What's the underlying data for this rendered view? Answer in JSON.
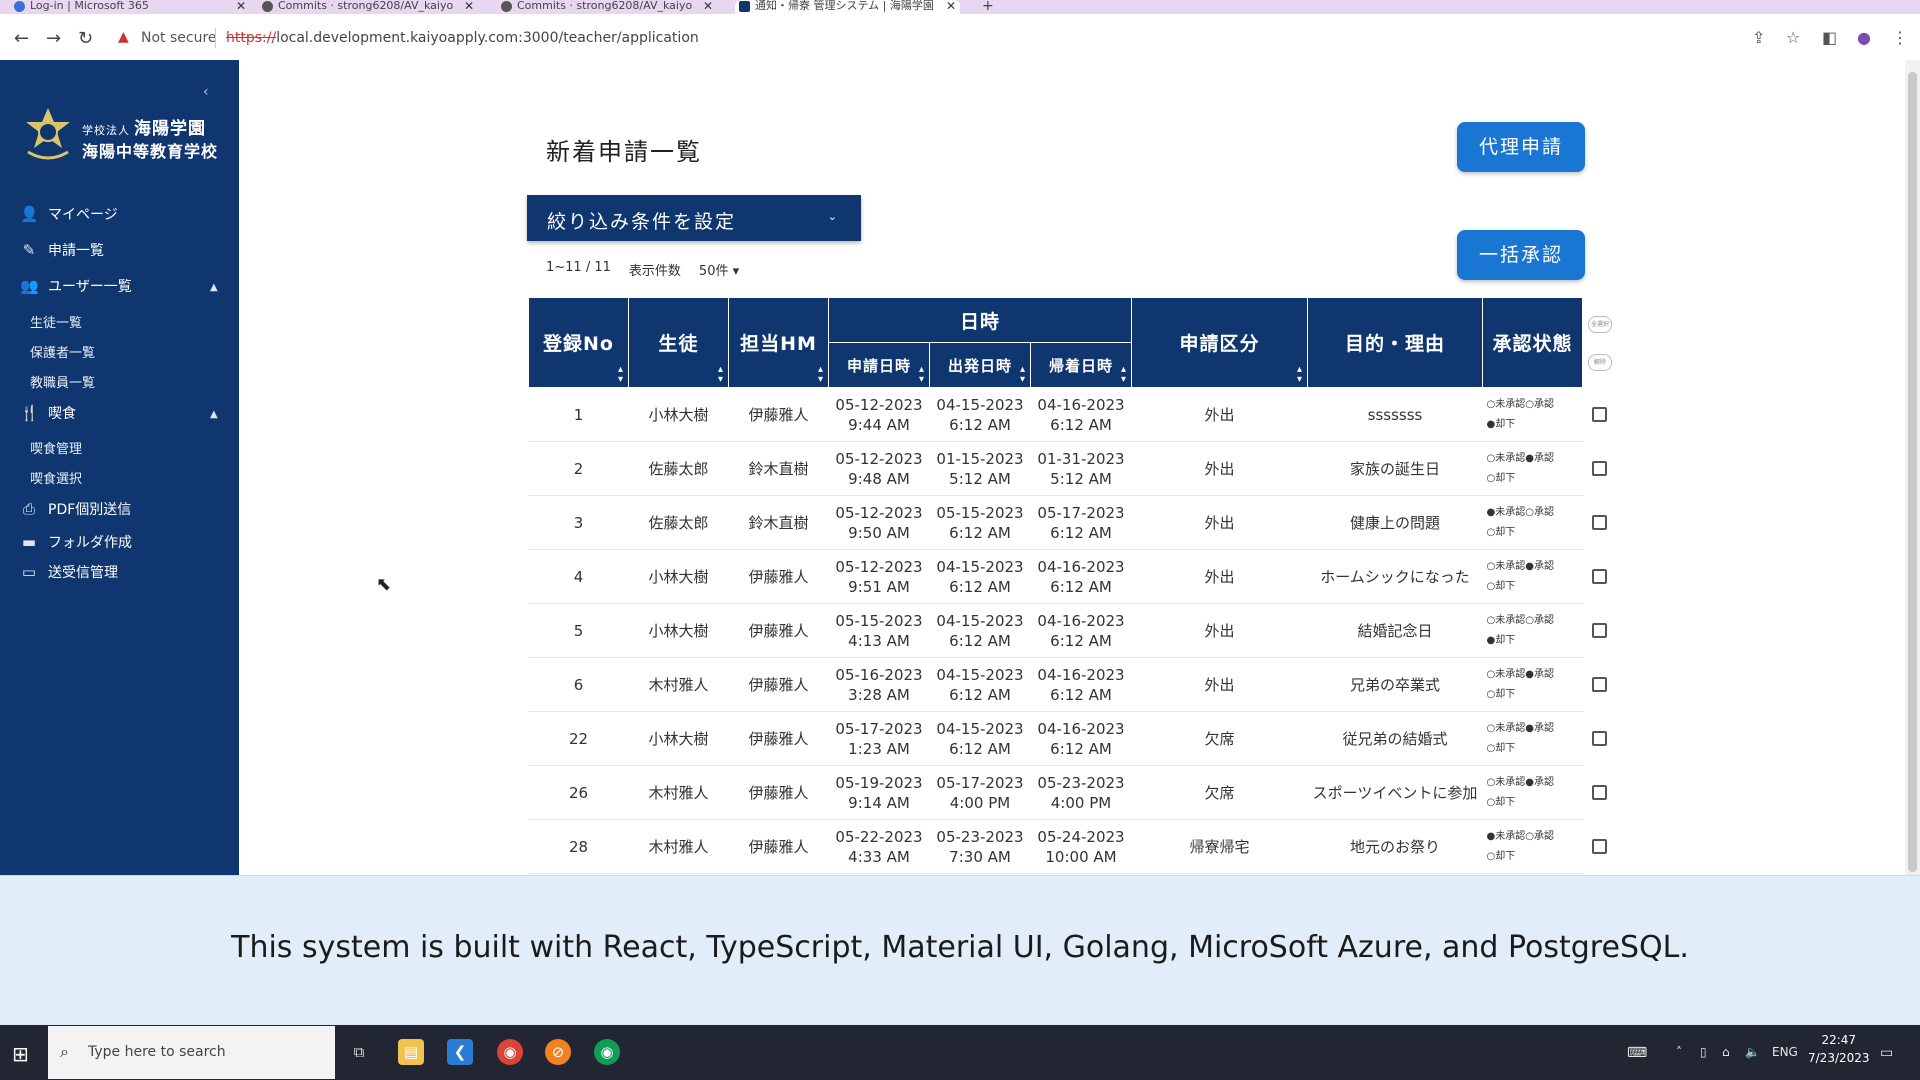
{
  "browser": {
    "tabs": [
      {
        "title": "Log-in | Microsoft 365"
      },
      {
        "title": "Commits · strong6208/AV_kaiyo"
      },
      {
        "title": "Commits · strong6208/AV_kaiyo"
      },
      {
        "title": "通知・帰寮 管理システム | 海陽学園"
      }
    ],
    "new_tab": "+",
    "not_secure": "Not secure",
    "url_scheme": "https://",
    "url_rest": "local.development.kaiyoapply.com:3000/teacher/application"
  },
  "sidebar": {
    "school_prefix": "学校法人",
    "school_name": "海陽学園",
    "school_sub": "海陽中等教育学校",
    "items": [
      {
        "label": "マイページ",
        "icon": "person-icon"
      },
      {
        "label": "申請一覧",
        "icon": "edit-icon"
      },
      {
        "label": "ユーザー一覧",
        "icon": "people-icon"
      },
      {
        "label": "生徒一覧"
      },
      {
        "label": "保護者一覧"
      },
      {
        "label": "教職員一覧"
      },
      {
        "label": "喫食",
        "icon": "meal-icon"
      },
      {
        "label": "喫食管理"
      },
      {
        "label": "喫食選択"
      },
      {
        "label": "PDF個別送信",
        "icon": "pdf-icon"
      },
      {
        "label": "フォルダ作成",
        "icon": "folder-icon"
      },
      {
        "label": "送受信管理",
        "icon": "inbox-icon"
      }
    ]
  },
  "main": {
    "title": "新着申請一覧",
    "proxy_button": "代理申請",
    "bulk_button": "一括承認",
    "filter_label": "絞り込み条件を設定",
    "range": "1~11 / 11",
    "per_page_label": "表示件数",
    "per_page_value": "50件",
    "columns": {
      "no": "登録No",
      "student": "生徒",
      "hm": "担当HM",
      "datetime": "日時",
      "applied": "申請日時",
      "depart": "出発日時",
      "return": "帰着日時",
      "category": "申請区分",
      "reason": "目的・理由",
      "status": "承認状態"
    },
    "status_labels": {
      "pending": "未承認",
      "approved": "承認",
      "rejected": "却下"
    },
    "rows": [
      {
        "no": "1",
        "student": "小林大樹",
        "hm": "伊藤雅人",
        "applied": "05-12-2023\n9:44 AM",
        "depart": "04-15-2023\n6:12 AM",
        "ret": "04-16-2023\n6:12 AM",
        "category": "外出",
        "reason": "sssssss",
        "status": "rejected"
      },
      {
        "no": "2",
        "student": "佐藤太郎",
        "hm": "鈴木直樹",
        "applied": "05-12-2023\n9:48 AM",
        "depart": "01-15-2023\n5:12 AM",
        "ret": "01-31-2023\n5:12 AM",
        "category": "外出",
        "reason": "家族の誕生日",
        "status": "approved"
      },
      {
        "no": "3",
        "student": "佐藤太郎",
        "hm": "鈴木直樹",
        "applied": "05-12-2023\n9:50 AM",
        "depart": "05-15-2023\n6:12 AM",
        "ret": "05-17-2023\n6:12 AM",
        "category": "外出",
        "reason": "健康上の問題",
        "status": "pending"
      },
      {
        "no": "4",
        "student": "小林大樹",
        "hm": "伊藤雅人",
        "applied": "05-12-2023\n9:51 AM",
        "depart": "04-15-2023\n6:12 AM",
        "ret": "04-16-2023\n6:12 AM",
        "category": "外出",
        "reason": "ホームシックになった",
        "status": "approved"
      },
      {
        "no": "5",
        "student": "小林大樹",
        "hm": "伊藤雅人",
        "applied": "05-15-2023\n4:13 AM",
        "depart": "04-15-2023\n6:12 AM",
        "ret": "04-16-2023\n6:12 AM",
        "category": "外出",
        "reason": "結婚記念日",
        "status": "rejected"
      },
      {
        "no": "6",
        "student": "木村雅人",
        "hm": "伊藤雅人",
        "applied": "05-16-2023\n3:28 AM",
        "depart": "04-15-2023\n6:12 AM",
        "ret": "04-16-2023\n6:12 AM",
        "category": "外出",
        "reason": "兄弟の卒業式",
        "status": "approved"
      },
      {
        "no": "22",
        "student": "小林大樹",
        "hm": "伊藤雅人",
        "applied": "05-17-2023\n1:23 AM",
        "depart": "04-15-2023\n6:12 AM",
        "ret": "04-16-2023\n6:12 AM",
        "category": "欠席",
        "reason": "従兄弟の結婚式",
        "status": "approved"
      },
      {
        "no": "26",
        "student": "木村雅人",
        "hm": "伊藤雅人",
        "applied": "05-19-2023\n9:14 AM",
        "depart": "05-17-2023\n4:00 PM",
        "ret": "05-23-2023\n4:00 PM",
        "category": "欠席",
        "reason": "スポーツイベントに参加",
        "status": "approved"
      },
      {
        "no": "28",
        "student": "木村雅人",
        "hm": "伊藤雅人",
        "applied": "05-22-2023\n4:33 AM",
        "depart": "05-23-2023\n7:30 AM",
        "ret": "05-24-2023\n10:00 AM",
        "category": "帰寮帰宅",
        "reason": "地元のお祭り",
        "status": "pending"
      }
    ]
  },
  "caption": "This system is built with React, TypeScript, Material UI, Golang, MicroSoft Azure, and PostgreSQL.",
  "taskbar": {
    "search_placeholder": "Type here to search",
    "lang": "ENG",
    "time": "22:47",
    "date": "7/23/2023"
  },
  "colors": {
    "sidebar": "#10366f",
    "primary": "#1976d2",
    "caption_bg": "#e1eef9"
  }
}
